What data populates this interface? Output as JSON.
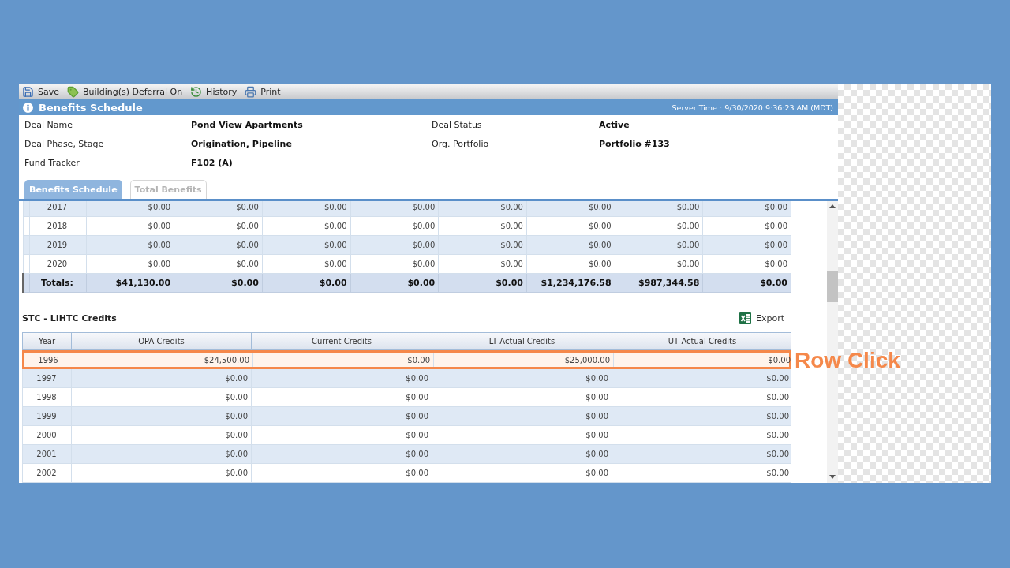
{
  "toolbar": [
    {
      "kind": "save",
      "label": "Save"
    },
    {
      "kind": "tag",
      "label": "Building(s) Deferral On"
    },
    {
      "kind": "history",
      "label": "History"
    },
    {
      "kind": "print",
      "label": "Print"
    }
  ],
  "header": {
    "title": "Benefits Schedule",
    "server_time": "Server Time : 9/30/2020 9:36:23 AM (MDT)"
  },
  "details": [
    {
      "label": "Deal Name",
      "value": "Pond View Apartments"
    },
    {
      "label": "Deal Status",
      "value": "Active"
    },
    {
      "label": "Deal Phase, Stage",
      "value": "Origination, Pipeline"
    },
    {
      "label": "Org. Portfolio",
      "value": "Portfolio #133"
    },
    {
      "label": "Fund Tracker",
      "value": "F102 (A)"
    }
  ],
  "tabs": [
    {
      "label": "Benefits Schedule",
      "selected": true
    },
    {
      "label": "Total Benefits",
      "selected": false
    }
  ],
  "schedule": {
    "rows": [
      {
        "year": "2017",
        "values": [
          "$0.00",
          "$0.00",
          "$0.00",
          "$0.00",
          "$0.00",
          "$0.00",
          "$0.00",
          "$0.00"
        ]
      },
      {
        "year": "2018",
        "values": [
          "$0.00",
          "$0.00",
          "$0.00",
          "$0.00",
          "$0.00",
          "$0.00",
          "$0.00",
          "$0.00"
        ]
      },
      {
        "year": "2019",
        "values": [
          "$0.00",
          "$0.00",
          "$0.00",
          "$0.00",
          "$0.00",
          "$0.00",
          "$0.00",
          "$0.00"
        ]
      },
      {
        "year": "2020",
        "values": [
          "$0.00",
          "$0.00",
          "$0.00",
          "$0.00",
          "$0.00",
          "$0.00",
          "$0.00",
          "$0.00"
        ]
      }
    ],
    "totals": {
      "label": "Totals:",
      "values": [
        "$41,130.00",
        "$0.00",
        "$0.00",
        "$0.00",
        "$0.00",
        "$1,234,176.58",
        "$987,344.58",
        "$0.00"
      ]
    }
  },
  "credits": {
    "title": "STC - LIHTC Credits",
    "export": "Export",
    "columns": [
      "Year",
      "OPA Credits",
      "Current Credits",
      "LT Actual Credits",
      "UT Actual Credits"
    ],
    "rows": [
      {
        "year": "1996",
        "values": [
          "$24,500.00",
          "$0.00",
          "$25,000.00",
          "$0.00"
        ],
        "selected": true
      },
      {
        "year": "1997",
        "values": [
          "$0.00",
          "$0.00",
          "$0.00",
          "$0.00"
        ],
        "selected": false
      },
      {
        "year": "1998",
        "values": [
          "$0.00",
          "$0.00",
          "$0.00",
          "$0.00"
        ],
        "selected": false
      },
      {
        "year": "1999",
        "values": [
          "$0.00",
          "$0.00",
          "$0.00",
          "$0.00"
        ],
        "selected": false
      },
      {
        "year": "2000",
        "values": [
          "$0.00",
          "$0.00",
          "$0.00",
          "$0.00"
        ],
        "selected": false
      },
      {
        "year": "2001",
        "values": [
          "$0.00",
          "$0.00",
          "$0.00",
          "$0.00"
        ],
        "selected": false
      },
      {
        "year": "2002",
        "values": [
          "$0.00",
          "$0.00",
          "$0.00",
          "$0.00"
        ],
        "selected": false
      }
    ]
  },
  "annotation": {
    "text": "Row Click"
  }
}
